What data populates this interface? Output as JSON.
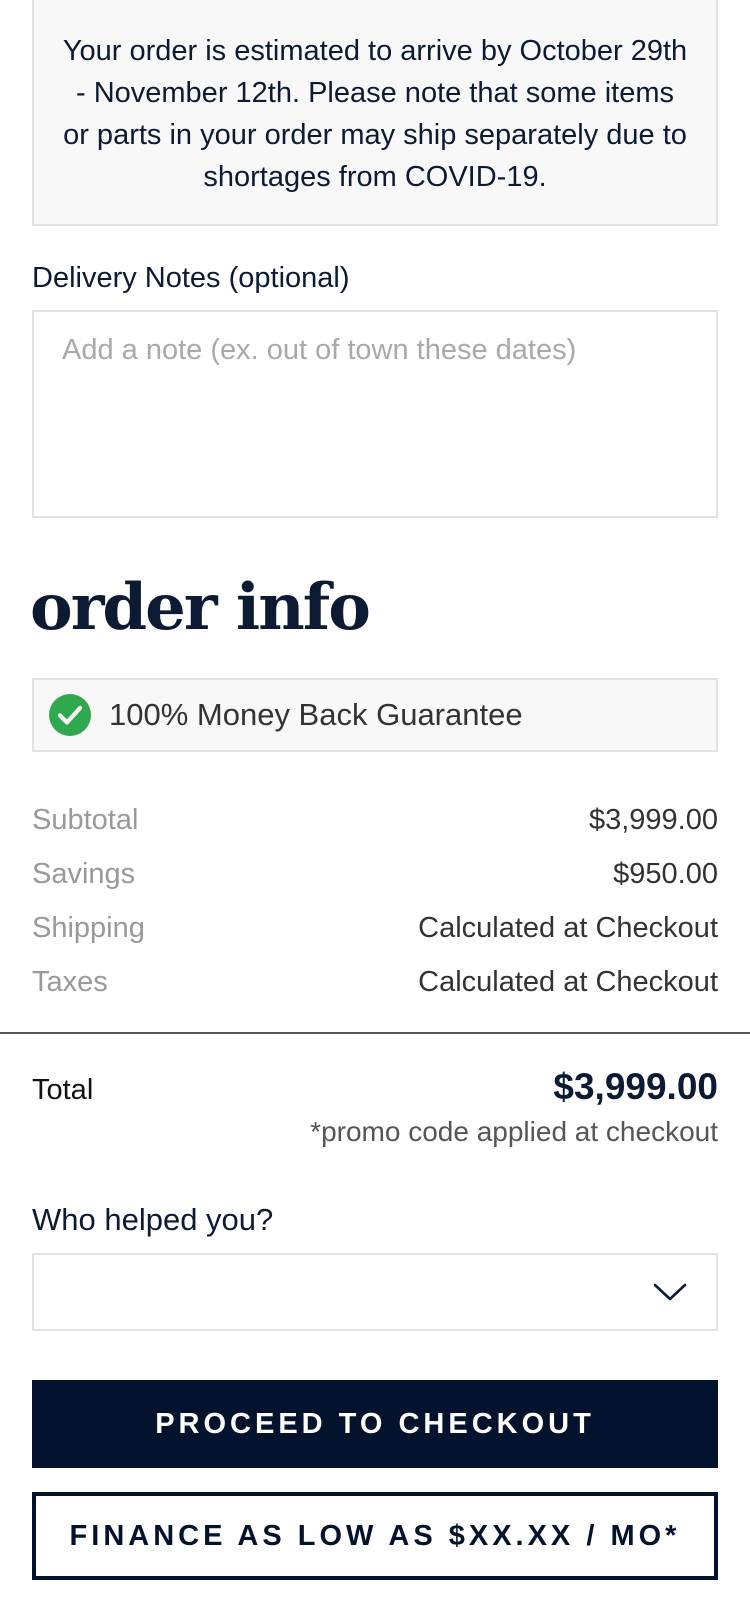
{
  "delivery_notice": {
    "text": "Your order is estimated to arrive by October 29th - November 12th. Please note that some items or parts in your order may ship separately due to shortages from COVID-19."
  },
  "delivery_notes": {
    "label": "Delivery Notes (optional)",
    "placeholder": "Add a note (ex. out of town these dates)",
    "value": ""
  },
  "order_info": {
    "title": "order info",
    "guarantee": {
      "icon": "check-circle-icon",
      "text": "100% Money Back Guarantee",
      "icon_color": "#2fa84f"
    },
    "summary": [
      {
        "label": "Subtotal",
        "value": "$3,999.00"
      },
      {
        "label": "Savings",
        "value": "$950.00"
      },
      {
        "label": "Shipping",
        "value": "Calculated at Checkout"
      },
      {
        "label": "Taxes",
        "value": "Calculated at Checkout"
      }
    ],
    "total": {
      "label": "Total",
      "value": "$3,999.00",
      "note": "*promo code applied at checkout"
    }
  },
  "helper": {
    "label": "Who helped you?",
    "selected": "",
    "icon": "chevron-down-icon"
  },
  "actions": {
    "checkout_label": "PROCEED TO CHECKOUT",
    "finance_label": "FINANCE AS LOW AS $XX.XX / MO*"
  },
  "colors": {
    "brand_navy": "#04132d",
    "success_green": "#2fa84f"
  }
}
